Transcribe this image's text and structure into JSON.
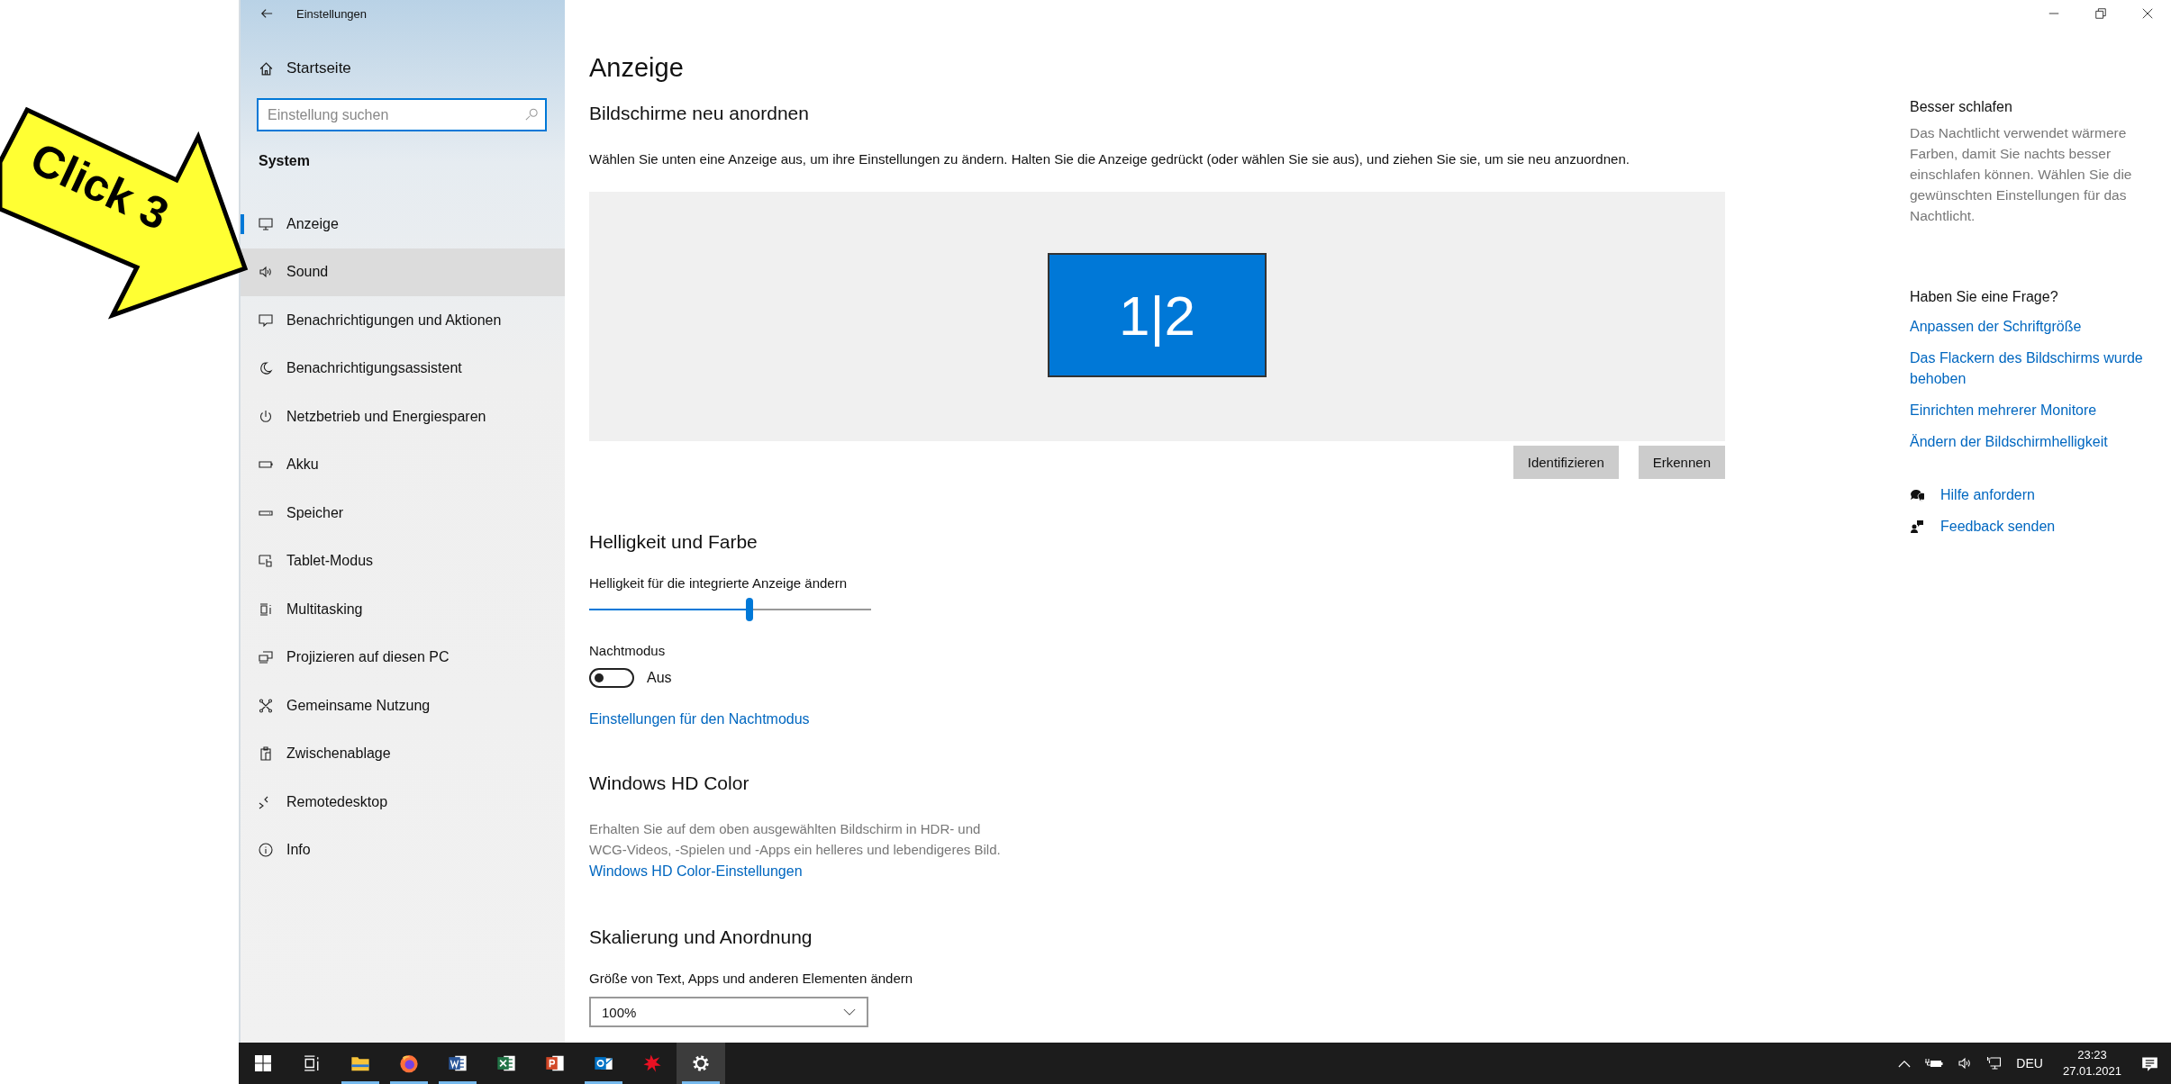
{
  "callout": {
    "label": "Click 3"
  },
  "window": {
    "title": "Einstellungen"
  },
  "sidebar": {
    "home": "Startseite",
    "search": {
      "placeholder": "Einstellung suchen"
    },
    "section": "System",
    "items": [
      {
        "label": "Anzeige",
        "kind": "monitor",
        "selected": true,
        "hovered": false
      },
      {
        "label": "Sound",
        "kind": "sound",
        "selected": false,
        "hovered": true
      },
      {
        "label": "Benachrichtigungen und Aktionen",
        "kind": "notify",
        "selected": false,
        "hovered": false
      },
      {
        "label": "Benachrichtigungsassistent",
        "kind": "moon",
        "selected": false,
        "hovered": false
      },
      {
        "label": "Netzbetrieb und Energiesparen",
        "kind": "power",
        "selected": false,
        "hovered": false
      },
      {
        "label": "Akku",
        "kind": "battery",
        "selected": false,
        "hovered": false
      },
      {
        "label": "Speicher",
        "kind": "storage",
        "selected": false,
        "hovered": false
      },
      {
        "label": "Tablet-Modus",
        "kind": "tablet",
        "selected": false,
        "hovered": false
      },
      {
        "label": "Multitasking",
        "kind": "multitasking",
        "selected": false,
        "hovered": false
      },
      {
        "label": "Projizieren auf diesen PC",
        "kind": "project",
        "selected": false,
        "hovered": false
      },
      {
        "label": "Gemeinsame Nutzung",
        "kind": "share",
        "selected": false,
        "hovered": false
      },
      {
        "label": "Zwischenablage",
        "kind": "clipboard",
        "selected": false,
        "hovered": false
      },
      {
        "label": "Remotedesktop",
        "kind": "remote",
        "selected": false,
        "hovered": false
      },
      {
        "label": "Info",
        "kind": "info",
        "selected": false,
        "hovered": false
      }
    ]
  },
  "main": {
    "title": "Anzeige",
    "arrange": {
      "heading": "Bildschirme neu anordnen",
      "description": "Wählen Sie unten eine Anzeige aus, um ihre Einstellungen zu ändern. Halten Sie die Anzeige gedrückt (oder wählen Sie sie aus), und ziehen Sie sie, um sie neu anzuordnen.",
      "monitor_label": "1|2",
      "buttons": [
        "Identifizieren",
        "Erkennen"
      ]
    },
    "brightness": {
      "heading": "Helligkeit und Farbe",
      "label": "Helligkeit für die integrierte Anzeige ändern",
      "level": 0.57
    },
    "night": {
      "label": "Nachtmodus",
      "on": false,
      "state_text": "Aus",
      "link": "Einstellungen für den Nachtmodus"
    },
    "hdr": {
      "heading": "Windows HD Color",
      "description": "Erhalten Sie auf dem oben ausgewählten Bildschirm in HDR- und WCG-Videos, -Spielen und -Apps ein helleres und lebendigeres Bild.",
      "link": "Windows HD Color-Einstellungen"
    },
    "scaling": {
      "heading": "Skalierung und Anordnung",
      "label": "Größe von Text, Apps und anderen Elementen ändern",
      "value": "100%"
    }
  },
  "aside": {
    "sleep": {
      "heading": "Besser schlafen",
      "text": "Das Nachtlicht verwendet wärmere Farben, damit Sie nachts besser einschlafen können. Wählen Sie die gewünschten Einstellungen für das Nachtlicht."
    },
    "question": {
      "heading": "Haben Sie eine Frage?",
      "links": [
        "Anpassen der Schriftgröße",
        "Das Flackern des Bildschirms wurde behoben",
        "Einrichten mehrerer Monitore",
        "Ändern der Bildschirmhelligkeit"
      ]
    },
    "help": [
      {
        "label": "Hilfe anfordern",
        "kind": "chat"
      },
      {
        "label": "Feedback senden",
        "kind": "feedback"
      }
    ]
  },
  "taskbar": {
    "apps": [
      {
        "kind": "windows",
        "running": false,
        "active": false
      },
      {
        "kind": "taskview",
        "running": false,
        "active": false
      },
      {
        "kind": "explorer",
        "running": true,
        "active": false
      },
      {
        "kind": "firefox",
        "running": true,
        "active": false
      },
      {
        "kind": "word",
        "running": true,
        "active": false
      },
      {
        "kind": "excel",
        "running": false,
        "active": false
      },
      {
        "kind": "powerpoint",
        "running": false,
        "active": false
      },
      {
        "kind": "outlook",
        "running": true,
        "active": false
      },
      {
        "kind": "redapp",
        "running": false,
        "active": false
      },
      {
        "kind": "settings",
        "running": true,
        "active": true
      }
    ],
    "language": "DEU",
    "time": "23:23",
    "date": "27.01.2021"
  }
}
